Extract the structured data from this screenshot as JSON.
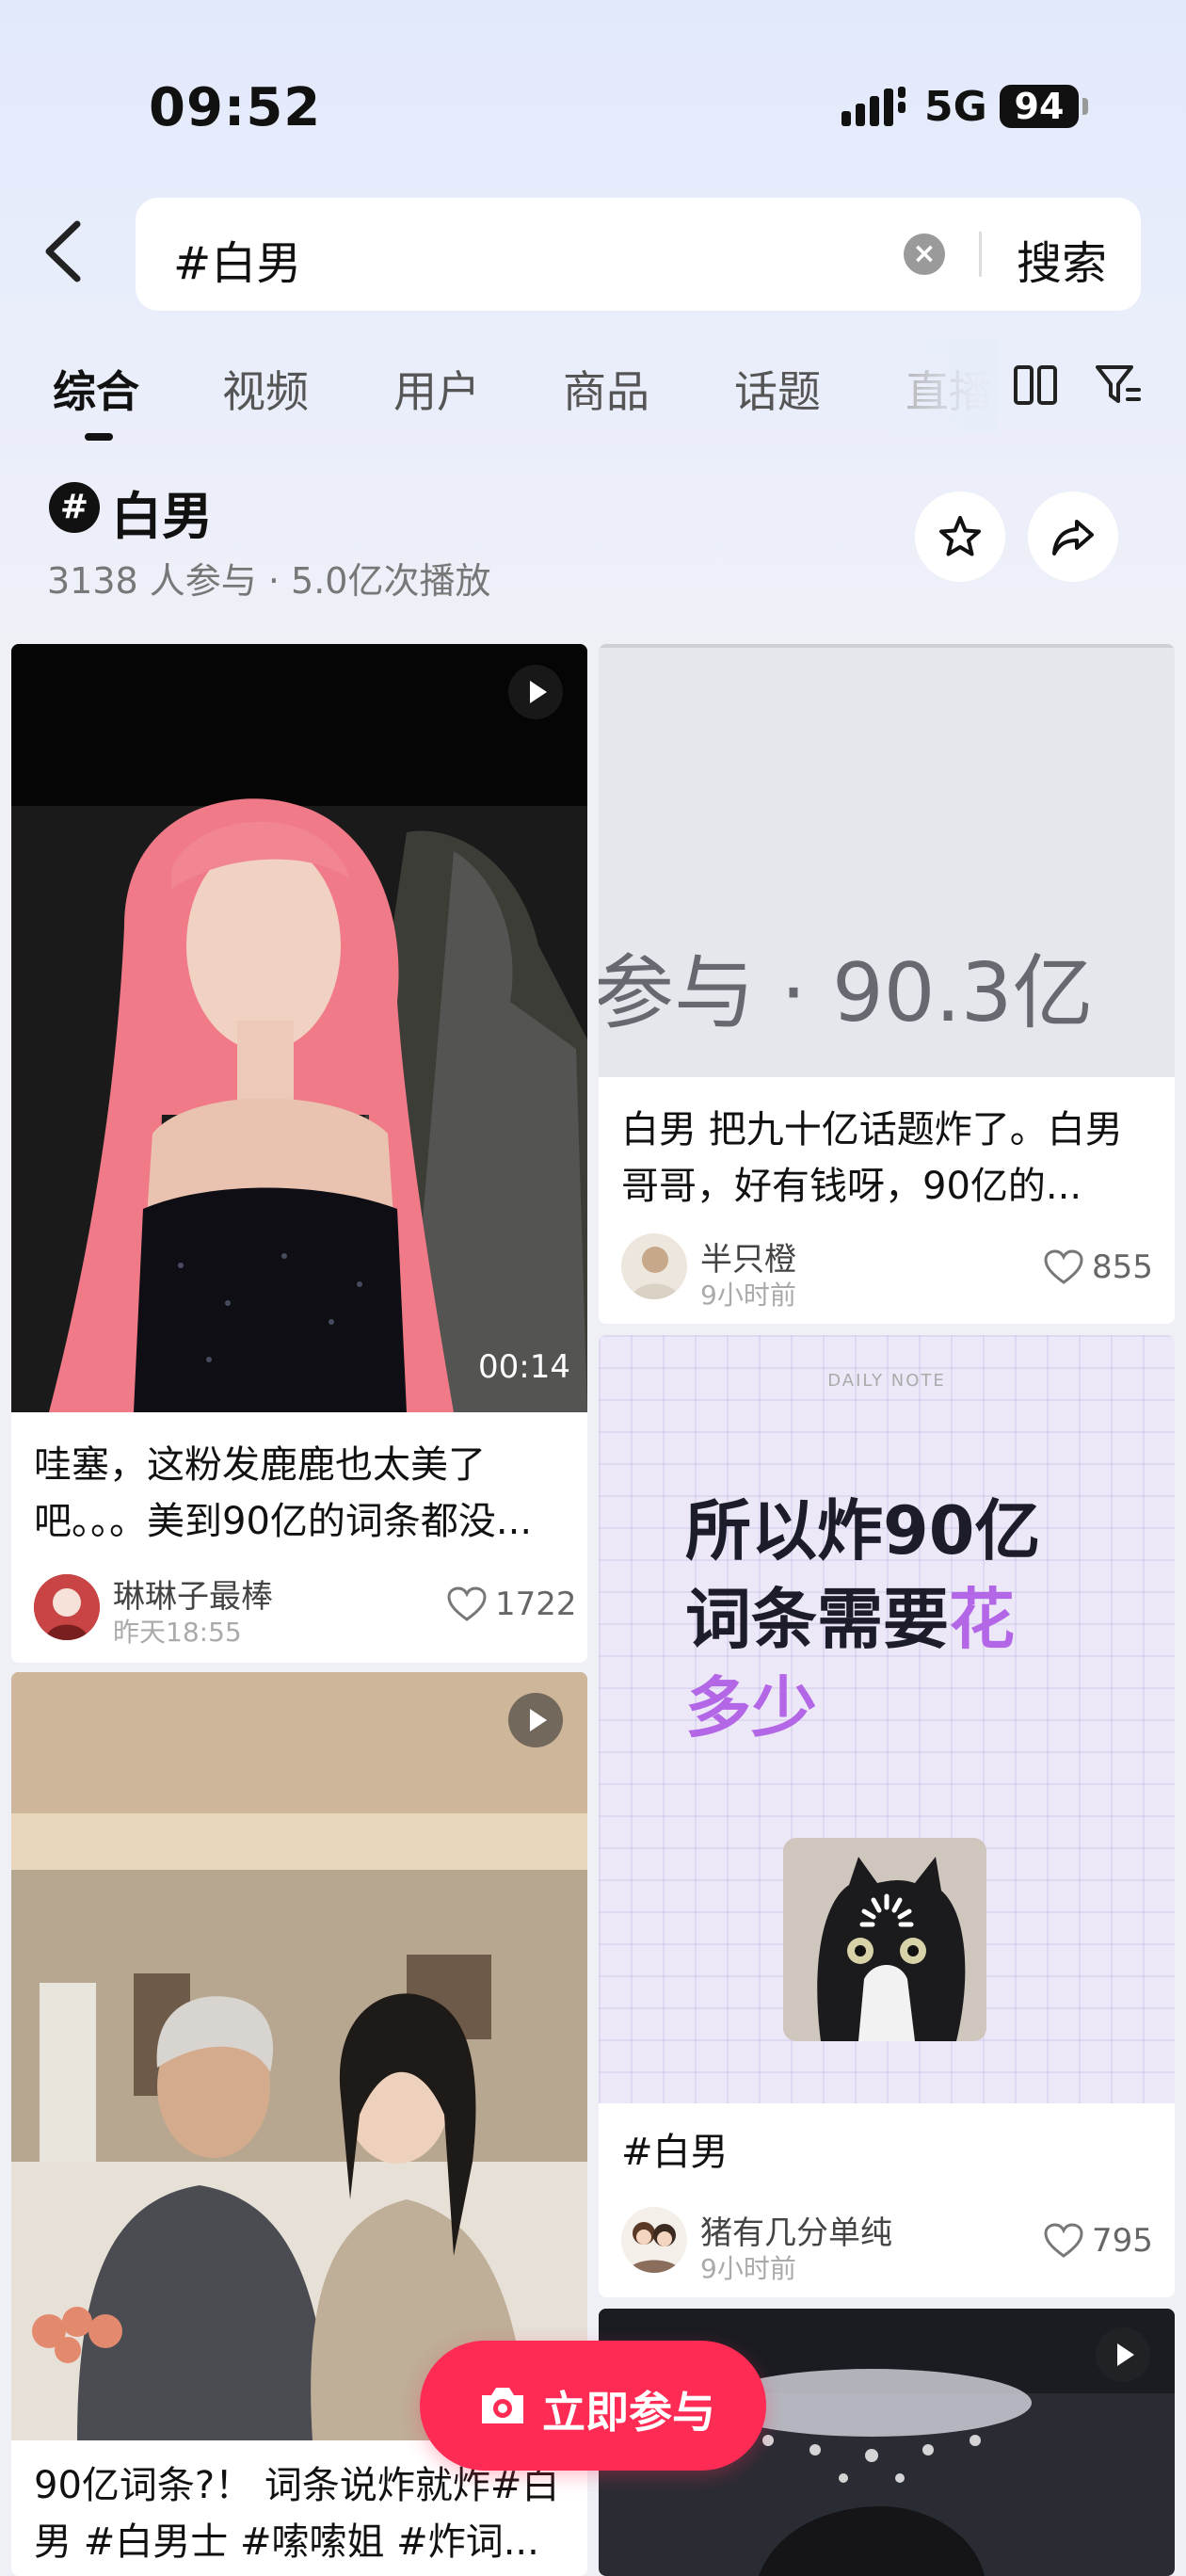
{
  "status_bar": {
    "time": "09:52",
    "network": "5G",
    "battery": "94"
  },
  "search": {
    "query": "#白男",
    "button_label": "搜索"
  },
  "tabs": [
    {
      "label": "综合"
    },
    {
      "label": "视频"
    },
    {
      "label": "用户"
    },
    {
      "label": "商品"
    },
    {
      "label": "话题"
    },
    {
      "label": "直播"
    }
  ],
  "topic": {
    "hash": "#",
    "title": "白男",
    "stats": "3138 人参与 · 5.0亿次播放"
  },
  "cards": [
    {
      "duration": "00:14",
      "title": "哇塞，这粉发鹿鹿也太美了吧。。。美到90亿的词条都没...",
      "author": "琳琳子最棒",
      "time": "昨天18:55",
      "likes": "1722"
    },
    {
      "thumb_text": "参与 · 90.3亿",
      "title": "白男  把九十亿话题炸了。白男哥哥，好有钱呀，90亿的...",
      "author": "半只橙",
      "time": "9小时前",
      "likes": "855"
    },
    {
      "note_label": "DAILY NOTE",
      "note_line1": "所以炸90亿",
      "note_line2": "词条需要",
      "note_highlight1": "花",
      "note_highlight2": "多少",
      "title": "#白男",
      "author": "猪有几分单纯",
      "time": "9小时前",
      "likes": "795"
    },
    {
      "title": "90亿词条?！ 词条说炸就炸#白男 #白男士 #嗦嗦姐 #炸词..."
    }
  ],
  "join_button": {
    "label": "立即参与"
  },
  "colors": {
    "accent": "#fe2c55",
    "note_purple": "#b366e6"
  }
}
